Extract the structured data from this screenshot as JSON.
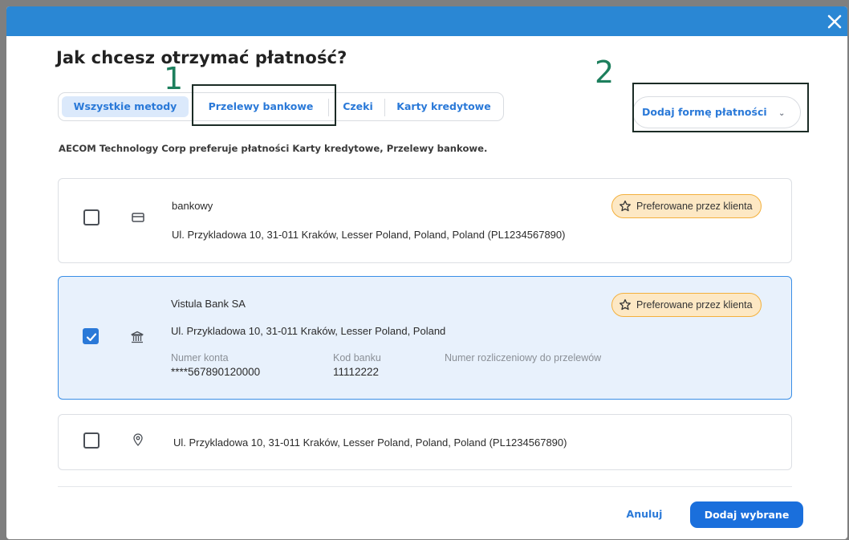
{
  "dialog": {
    "title": "Jak chcesz otrzymać płatność?",
    "close_icon": "close-icon"
  },
  "annotations": [
    "1",
    "2"
  ],
  "tabs": [
    {
      "label": "Wszystkie metody",
      "active": true
    },
    {
      "label": "Przelewy bankowe",
      "active": false
    },
    {
      "label": "Czeki",
      "active": false
    },
    {
      "label": "Karty kredytowe",
      "active": false
    }
  ],
  "add_method": {
    "label": "Dodaj formę płatności",
    "icon": "chevron-down-icon"
  },
  "preference_note": "AECOM Technology Corp preferuje płatności Karty kredytowe, Przelewy bankowe.",
  "methods": [
    {
      "checked": false,
      "icon": "card-icon",
      "name": "bankowy",
      "address": "Ul. Przykladowa 10, 31-011 Kraków, Lesser Poland, Poland, Poland (PL1234567890)",
      "badge": "Preferowane przez klienta"
    },
    {
      "checked": true,
      "icon": "bank-icon",
      "name": "Vistula Bank SA",
      "address": "Ul. Przykladowa 10, 31-011 Kraków, Lesser Poland, Poland",
      "badge": "Preferowane przez klienta",
      "details": [
        {
          "label": "Numer konta",
          "value": "****567890120000"
        },
        {
          "label": "Kod banku",
          "value": "11112222"
        },
        {
          "label": "Numer rozliczeniowy do przelewów",
          "value": ""
        }
      ]
    },
    {
      "checked": false,
      "icon": "location-pin-icon",
      "address": "Ul. Przykladowa 10, 31-011 Kraków, Lesser Poland, Poland, Poland (PL1234567890)"
    }
  ],
  "footer": {
    "cancel_label": "Anuluj",
    "submit_label": "Dodaj wybrane"
  },
  "colors": {
    "accent": "#2a79d8",
    "header": "#2a87d4",
    "badge_bg": "#fde8c4",
    "badge_border": "#f3b03d",
    "annotation": "#1d7f5d"
  }
}
